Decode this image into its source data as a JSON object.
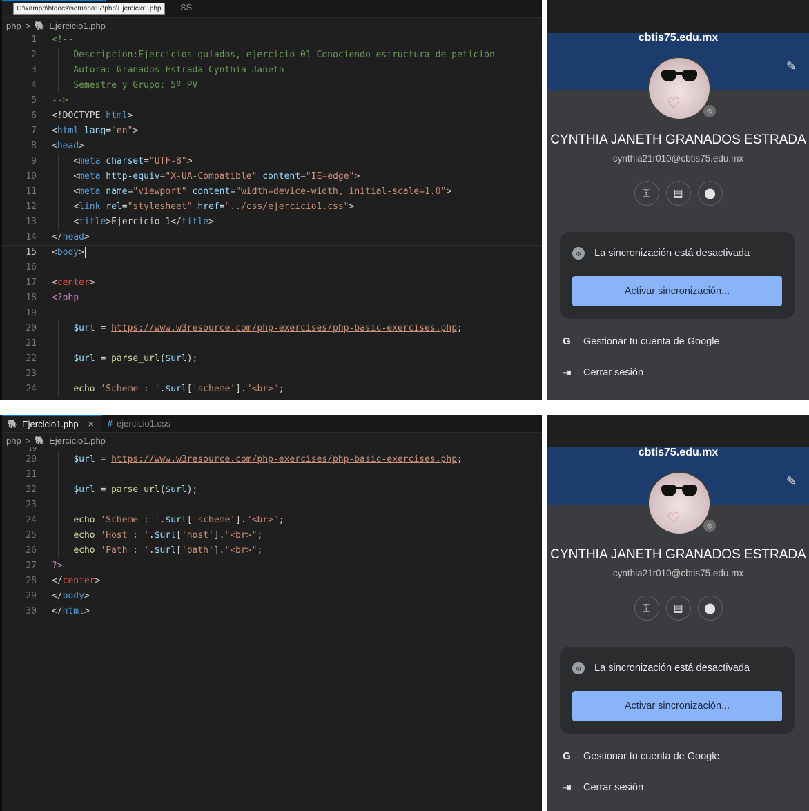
{
  "top": {
    "tooltip": "C:\\xampp\\htdocs\\semana17\\php\\Ejercicio1.php",
    "tab_ghost": "SS",
    "breadcrumb": {
      "folder": "php",
      "sep": ">",
      "file": "Ejercicio1.php"
    },
    "lines": [
      {
        "n": "1"
      },
      {
        "n": "2"
      },
      {
        "n": "3"
      },
      {
        "n": "4"
      },
      {
        "n": "5"
      },
      {
        "n": "6"
      },
      {
        "n": "7"
      },
      {
        "n": "8"
      },
      {
        "n": "9"
      },
      {
        "n": "10"
      },
      {
        "n": "11"
      },
      {
        "n": "12"
      },
      {
        "n": "13"
      },
      {
        "n": "14"
      },
      {
        "n": "15"
      },
      {
        "n": "16"
      },
      {
        "n": "17"
      },
      {
        "n": "18"
      },
      {
        "n": "19"
      },
      {
        "n": "20"
      },
      {
        "n": "21"
      },
      {
        "n": "22"
      },
      {
        "n": "23"
      },
      {
        "n": "24"
      }
    ],
    "code": {
      "l1": "<!--",
      "l2": "Descripcion:Ejercicios guiados, ejercicio 01 Conociendo estructura de petición",
      "l3": "Autora: Granados Estrada Cynthia Janeth",
      "l4": "Semestre y Grupo: 5º PV",
      "l5": "-->",
      "doctype_open": "<!DOCTYPE ",
      "doctype_html": "html",
      "doctype_close": ">"
    }
  },
  "bottom": {
    "tabs": [
      {
        "label": "Ejercicio1.php",
        "close": "×"
      },
      {
        "label": "ejercicio1.css",
        "hash": "#"
      }
    ],
    "breadcrumb": {
      "folder": "php",
      "sep": ">",
      "file": "Ejercicio1.php"
    },
    "partial_line_number": "19"
  },
  "code_shared": {
    "url_string": "https://www.w3resource.com/php-exercises/php-basic-exercises.php",
    "scheme_label": "'Scheme : '",
    "scheme_key": "'scheme'",
    "host_label": "'Host : '",
    "host_key": "'host'",
    "path_label": "'Path : '",
    "path_key": "'path'",
    "br": "\"<br>\""
  },
  "profile": {
    "domain": "cbtis75.edu.mx",
    "name": "CYNTHIA JANETH GRANADOS ESTRADA",
    "email": "cynthia21r010@cbtis75.edu.mx",
    "sync_message": "La sincronización está desactivada",
    "sync_button": "Activar sincronización...",
    "manage_account": "Gestionar tu cuenta de Google",
    "logout": "Cerrar sesión",
    "icons": [
      "key-icon",
      "payment-card-icon",
      "location-pin-icon"
    ],
    "accent_color": "#8ab4f8",
    "header_color": "#1b3c6d"
  }
}
